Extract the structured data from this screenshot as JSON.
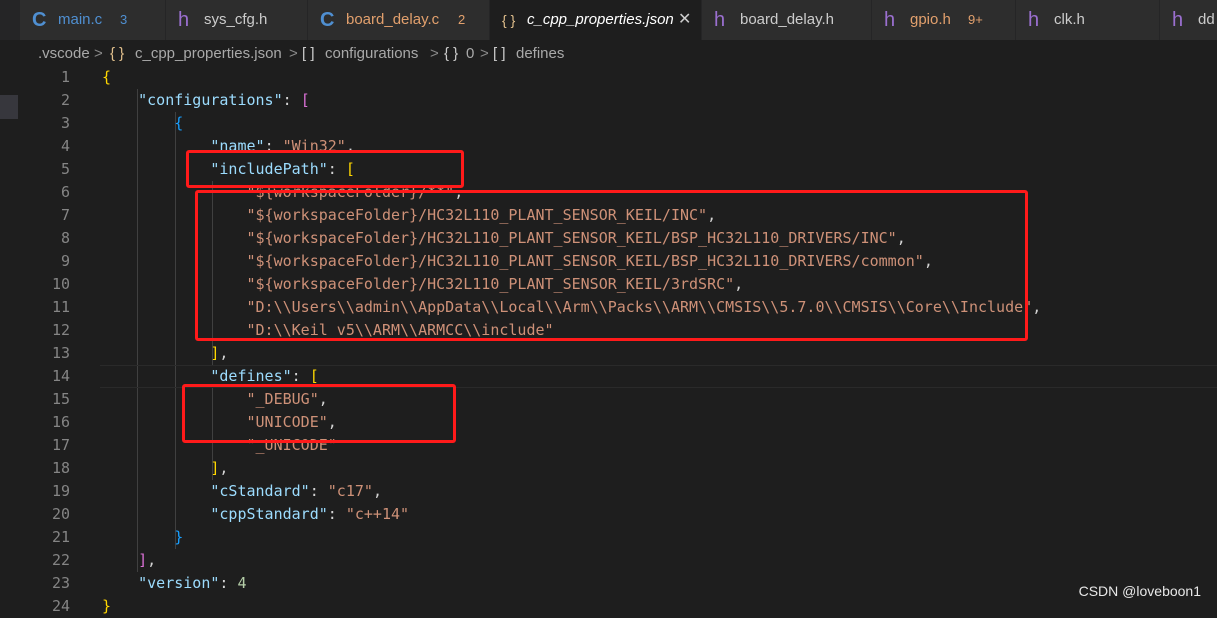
{
  "tabs": [
    {
      "icon": "C",
      "label": "main.c",
      "badge": "3",
      "color": "#4f8fd1"
    },
    {
      "icon": "h",
      "label": "sys_cfg.h",
      "badge": "",
      "color": "#cccccc"
    },
    {
      "icon": "C",
      "label": "board_delay.c",
      "badge": "2",
      "color": "#e2a06d"
    },
    {
      "icon": "{ }",
      "label": "c_cpp_properties.json",
      "badge": "",
      "close": "✕",
      "color": "#ffffff"
    },
    {
      "icon": "h",
      "label": "board_delay.h",
      "badge": "",
      "color": "#cccccc"
    },
    {
      "icon": "h",
      "label": "gpio.h",
      "badge": "9+",
      "color": "#e2a06d"
    },
    {
      "icon": "h",
      "label": "clk.h",
      "badge": "",
      "color": "#cccccc"
    },
    {
      "icon": "h",
      "label": "dd",
      "badge": "",
      "color": "#cccccc"
    }
  ],
  "breadcrumb": {
    "folder": ".vscode",
    "file_icon": "{ }",
    "file": "c_cpp_properties.json",
    "item1_icon": "[ ]",
    "item1": "configurations",
    "item2_icon": "{ }",
    "item2": "0",
    "item3_icon": "[ ]",
    "item3": "defines",
    "sep": ">"
  },
  "lines": [
    {
      "n": "1",
      "t": [
        [
          "b1",
          "{"
        ]
      ]
    },
    {
      "n": "2",
      "t": [
        [
          "p",
          "    "
        ],
        [
          "k",
          "\"configurations\""
        ],
        [
          "p",
          ": "
        ],
        [
          "b2",
          "["
        ]
      ]
    },
    {
      "n": "3",
      "t": [
        [
          "p",
          "        "
        ],
        [
          "b3",
          "{"
        ]
      ]
    },
    {
      "n": "4",
      "t": [
        [
          "p",
          "            "
        ],
        [
          "k",
          "\"name\""
        ],
        [
          "p",
          ": "
        ],
        [
          "s",
          "\"Win32\""
        ],
        [
          "p",
          ","
        ]
      ]
    },
    {
      "n": "5",
      "t": [
        [
          "p",
          "            "
        ],
        [
          "k",
          "\"includePath\""
        ],
        [
          "p",
          ": "
        ],
        [
          "b1",
          "["
        ]
      ]
    },
    {
      "n": "6",
      "t": [
        [
          "p",
          "                "
        ],
        [
          "s",
          "\"${workspaceFolder}/**\""
        ],
        [
          "p",
          ","
        ]
      ]
    },
    {
      "n": "7",
      "t": [
        [
          "p",
          "                "
        ],
        [
          "s",
          "\"${workspaceFolder}/HC32L110_PLANT_SENSOR_KEIL/INC\""
        ],
        [
          "p",
          ","
        ]
      ]
    },
    {
      "n": "8",
      "t": [
        [
          "p",
          "                "
        ],
        [
          "s",
          "\"${workspaceFolder}/HC32L110_PLANT_SENSOR_KEIL/BSP_HC32L110_DRIVERS/INC\""
        ],
        [
          "p",
          ","
        ]
      ]
    },
    {
      "n": "9",
      "t": [
        [
          "p",
          "                "
        ],
        [
          "s",
          "\"${workspaceFolder}/HC32L110_PLANT_SENSOR_KEIL/BSP_HC32L110_DRIVERS/common\""
        ],
        [
          "p",
          ","
        ]
      ]
    },
    {
      "n": "10",
      "t": [
        [
          "p",
          "                "
        ],
        [
          "s",
          "\"${workspaceFolder}/HC32L110_PLANT_SENSOR_KEIL/3rdSRC\""
        ],
        [
          "p",
          ","
        ]
      ]
    },
    {
      "n": "11",
      "t": [
        [
          "p",
          "                "
        ],
        [
          "s",
          "\"D:\\\\Users\\\\admin\\\\AppData\\\\Local\\\\Arm\\\\Packs\\\\ARM\\\\CMSIS\\\\5.7.0\\\\CMSIS\\\\Core\\\\Include\""
        ],
        [
          "p",
          ","
        ]
      ]
    },
    {
      "n": "12",
      "t": [
        [
          "p",
          "                "
        ],
        [
          "s",
          "\"D:\\\\Keil_v5\\\\ARM\\\\ARMCC\\\\include\""
        ]
      ]
    },
    {
      "n": "13",
      "t": [
        [
          "p",
          "            "
        ],
        [
          "b1",
          "]"
        ],
        [
          "p",
          ","
        ]
      ]
    },
    {
      "n": "14",
      "t": [
        [
          "p",
          "            "
        ],
        [
          "k",
          "\"defines\""
        ],
        [
          "p",
          ": "
        ],
        [
          "b1",
          "["
        ]
      ]
    },
    {
      "n": "15",
      "t": [
        [
          "p",
          "                "
        ],
        [
          "s",
          "\"_DEBUG\""
        ],
        [
          "p",
          ","
        ]
      ]
    },
    {
      "n": "16",
      "t": [
        [
          "p",
          "                "
        ],
        [
          "s",
          "\"UNICODE\""
        ],
        [
          "p",
          ","
        ]
      ]
    },
    {
      "n": "17",
      "t": [
        [
          "p",
          "                "
        ],
        [
          "s",
          "\"_UNICODE\""
        ]
      ]
    },
    {
      "n": "18",
      "t": [
        [
          "p",
          "            "
        ],
        [
          "b1",
          "]"
        ],
        [
          "p",
          ","
        ]
      ]
    },
    {
      "n": "19",
      "t": [
        [
          "p",
          "            "
        ],
        [
          "k",
          "\"cStandard\""
        ],
        [
          "p",
          ": "
        ],
        [
          "s",
          "\"c17\""
        ],
        [
          "p",
          ","
        ]
      ]
    },
    {
      "n": "20",
      "t": [
        [
          "p",
          "            "
        ],
        [
          "k",
          "\"cppStandard\""
        ],
        [
          "p",
          ": "
        ],
        [
          "s",
          "\"c++14\""
        ]
      ]
    },
    {
      "n": "21",
      "t": [
        [
          "p",
          "        "
        ],
        [
          "b3",
          "}"
        ]
      ]
    },
    {
      "n": "22",
      "t": [
        [
          "p",
          "    "
        ],
        [
          "b2",
          "]"
        ],
        [
          "p",
          ","
        ]
      ]
    },
    {
      "n": "23",
      "t": [
        [
          "p",
          "    "
        ],
        [
          "k",
          "\"version\""
        ],
        [
          "p",
          ": "
        ],
        [
          "n",
          "4"
        ]
      ]
    },
    {
      "n": "24",
      "t": [
        [
          "b1",
          "}"
        ]
      ]
    }
  ],
  "watermark": "CSDN @loveboon1",
  "colors": {
    "annotation": "#ff1a1a",
    "background": "#1e1e1e"
  }
}
